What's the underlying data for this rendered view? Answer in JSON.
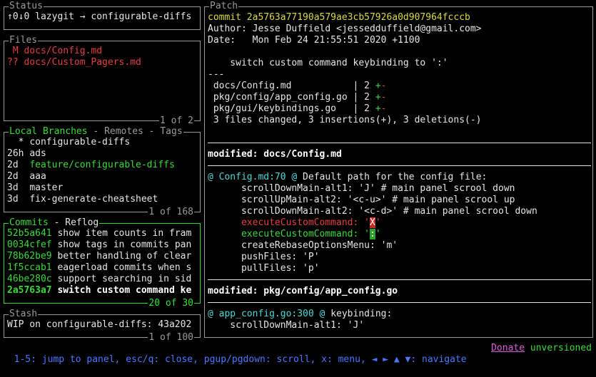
{
  "status": {
    "title": "Status",
    "text": "↑0↓0 lazygit → configurable-diffs"
  },
  "files": {
    "title": "Files",
    "footer": "1 of 2",
    "items": [
      {
        "status": "M",
        "path": "docs/Config.md"
      },
      {
        "status": "??",
        "path": "docs/Custom_Pagers.md"
      }
    ]
  },
  "branches": {
    "title_active": "Local Branches",
    "title_sep1": " - ",
    "title_remotes": "Remotes",
    "title_sep2": " - ",
    "title_tags": "Tags",
    "footer": "1 of 168",
    "items": [
      {
        "age": "",
        "marker": "*",
        "name": "configurable-diffs"
      },
      {
        "age": "26h",
        "marker": "",
        "name": "ads"
      },
      {
        "age": "2d",
        "marker": "",
        "name": "feature/configurable-diffs"
      },
      {
        "age": "2d",
        "marker": "",
        "name": "aaa"
      },
      {
        "age": "3d",
        "marker": "",
        "name": "master"
      },
      {
        "age": "3d",
        "marker": "",
        "name": "fix-generate-cheatsheet"
      }
    ]
  },
  "commits": {
    "title_active": "Commits",
    "title_sep": " - ",
    "title_reflog": "Reflog",
    "footer": "20 of 30",
    "items": [
      {
        "hash": "52b5a641",
        "message": "show item counts in fram"
      },
      {
        "hash": "0034cfef",
        "message": "show tags in commits pan"
      },
      {
        "hash": "78b62be9",
        "message": "better handling of clear"
      },
      {
        "hash": "1f5ccab1",
        "message": "eagerload commits when s"
      },
      {
        "hash": "46be280c",
        "message": "support searching in sid"
      },
      {
        "hash": "2a5763a7",
        "message": "switch custom command ke"
      }
    ]
  },
  "stash": {
    "title": "Stash",
    "footer": "1 of 100",
    "items": [
      {
        "text": "WIP on configurable-diffs: 43a202"
      }
    ]
  },
  "patch": {
    "title": "Patch",
    "commit_line": "commit 2a5763a77190a579ae3cb57926a0d907964fcccb",
    "author_line": "Author: Jesse Duffield <jessedduffield@gmail.com>",
    "date_line": "Date:   Mon Feb 24 21:55:51 2020 +1100",
    "message_line": "    switch custom command keybinding to ':'",
    "divider": "---",
    "stats": [
      {
        "file": " docs/Config.md           ",
        "sep": "| 2 ",
        "plus": "+",
        "minus": "-"
      },
      {
        "file": " pkg/config/app_config.go ",
        "sep": "| 2 ",
        "plus": "+",
        "minus": "-"
      },
      {
        "file": " pkg/gui/keybindings.go   ",
        "sep": "| 2 ",
        "plus": "+",
        "minus": "-"
      }
    ],
    "summary": " 3 files changed, 3 insertions(+), 3 deletions(-)",
    "file1_header": "modified: docs/Config.md",
    "hunk1_prefix": "@ Config.md:70 @",
    "hunk1_context": " Default path for the config file:",
    "hunk1_lines": [
      {
        "kind": "ctx",
        "text": "      scrollDownMain-alt1: 'J' # main panel scrool down"
      },
      {
        "kind": "ctx",
        "text": "      scrollUpMain-alt2: '<c-u>' # main panel scrool up"
      },
      {
        "kind": "ctx",
        "text": "      scrollDownMain-alt2: '<c-d>' # main panel scrool down"
      }
    ],
    "removed_pre": "      executeCustomCommand: '",
    "removed_hl": "X",
    "removed_post": "'",
    "added_pre": "      executeCustomCommand: '",
    "added_hl": ":",
    "added_post": "'",
    "hunk1_tail": [
      "      createRebaseOptionsMenu: 'm'",
      "      pushFiles: 'P'",
      "      pullFiles: 'p'"
    ],
    "file2_header": "modified: pkg/config/app_config.go",
    "hunk2_prefix": "@ app_config.go:300 @",
    "hunk2_context": " keybinding:",
    "hunk2_lines": [
      "    scrollDownMain-alt1: 'J'"
    ]
  },
  "bottom": {
    "help": "1-5: jump to panel, esc/q: close, pgup/pgdown: scroll, x: menu, ◄ ► ▲ ▼: navigate",
    "donate": "Donate",
    "version": "unversioned"
  },
  "colors": {
    "active_border": "#30e030",
    "inactive_border": "#9a9a9a",
    "help_text": "#4a78ff",
    "donate": "#d75fd7"
  }
}
